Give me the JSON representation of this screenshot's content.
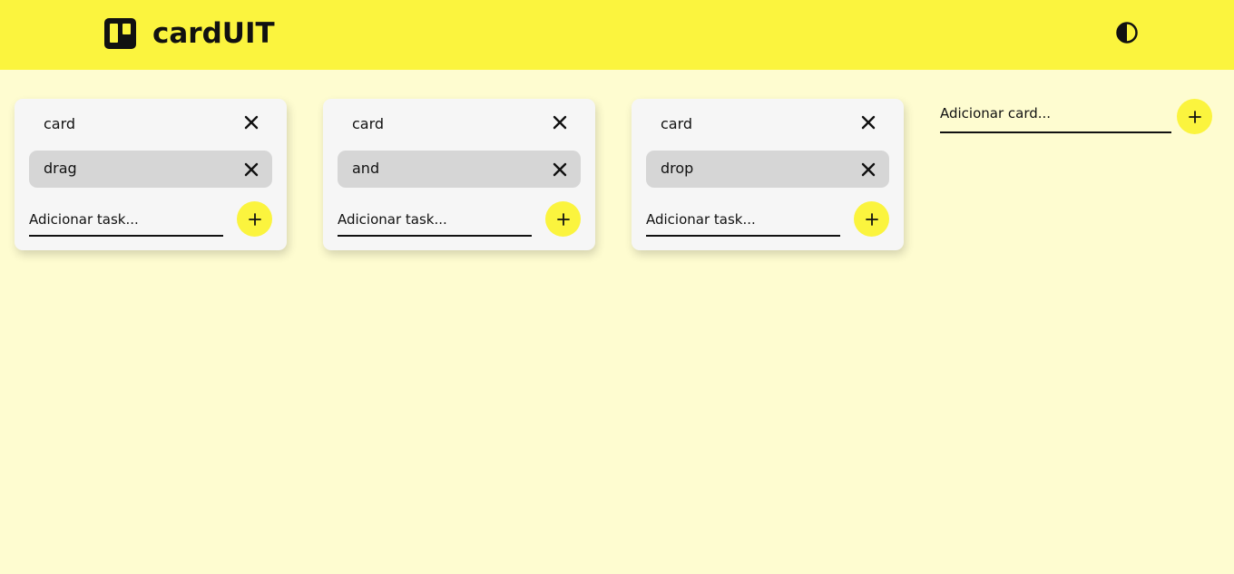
{
  "app": {
    "title": "cardUIT",
    "logo_icon": "trello-board-icon",
    "theme_icon": "contrast-half-circle-icon"
  },
  "colors": {
    "accent": "#fbf43e",
    "background": "#fefcd0",
    "card": "#f6f6f6",
    "task": "#d6d6d6",
    "text": "#111111"
  },
  "cards": [
    {
      "title": "card",
      "tasks": [
        {
          "label": "drag"
        }
      ],
      "add_task_placeholder": "Adicionar task...",
      "add_icon": "plus-icon",
      "close_icon": "close-icon"
    },
    {
      "title": "card",
      "tasks": [
        {
          "label": "and"
        }
      ],
      "add_task_placeholder": "Adicionar task...",
      "add_icon": "plus-icon",
      "close_icon": "close-icon"
    },
    {
      "title": "card",
      "tasks": [
        {
          "label": "drop"
        }
      ],
      "add_task_placeholder": "Adicionar task...",
      "add_icon": "plus-icon",
      "close_icon": "close-icon"
    }
  ],
  "new_card": {
    "placeholder": "Adicionar card...",
    "add_icon": "plus-icon"
  }
}
